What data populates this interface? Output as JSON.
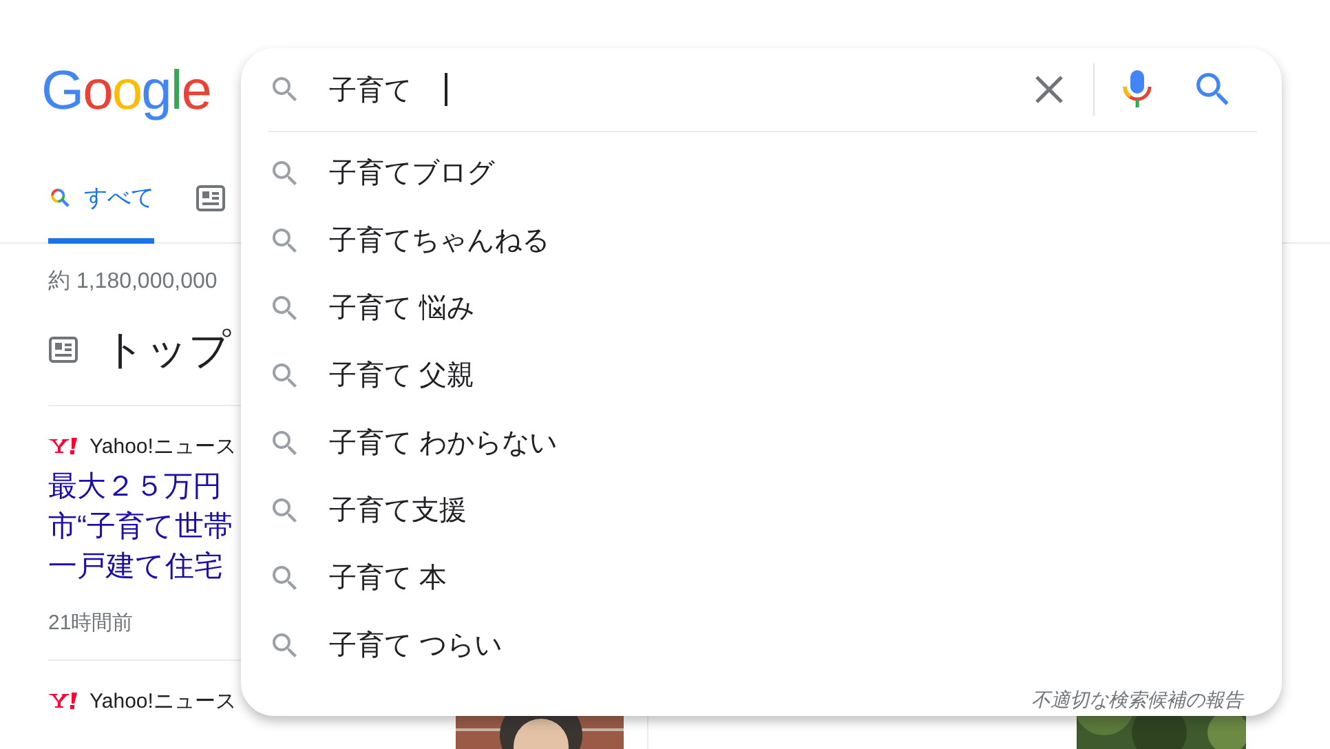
{
  "logo": "Google",
  "tabs": [
    {
      "kind": "all",
      "label": "すべて",
      "selected": true
    },
    {
      "kind": "news",
      "selected": false
    }
  ],
  "result_count": "約 1,180,000,000",
  "section_title": "トップ",
  "articles": [
    {
      "source": "Yahoo!ニュース",
      "title_lines": [
        "最大２５万円",
        "市“子育て世帯",
        "一戸建て住宅"
      ],
      "time": "21時間前"
    },
    {
      "source": "Yahoo!ニュース"
    }
  ],
  "search": {
    "value": "子育て"
  },
  "suggestions": [
    "子育てブログ",
    "子育てちゃんねる",
    "子育て 悩み",
    "子育て 父親",
    "子育て わからない",
    "子育て支援",
    "子育て 本",
    "子育て つらい"
  ],
  "report_link": "不適切な検索候補の報告"
}
